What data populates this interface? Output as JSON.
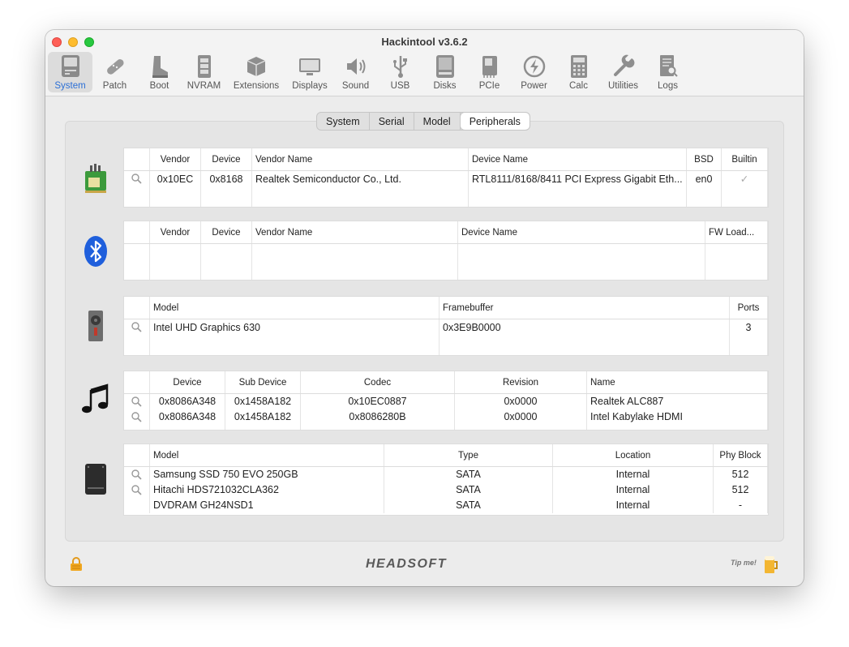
{
  "window": {
    "title": "Hackintool v3.6.2"
  },
  "toolbar": {
    "items": [
      {
        "label": "System",
        "icon": "system-icon"
      },
      {
        "label": "Patch",
        "icon": "patch-icon"
      },
      {
        "label": "Boot",
        "icon": "boot-icon"
      },
      {
        "label": "NVRAM",
        "icon": "nvram-icon"
      },
      {
        "label": "Extensions",
        "icon": "extensions-icon"
      },
      {
        "label": "Displays",
        "icon": "displays-icon"
      },
      {
        "label": "Sound",
        "icon": "sound-icon"
      },
      {
        "label": "USB",
        "icon": "usb-icon"
      },
      {
        "label": "Disks",
        "icon": "disks-icon"
      },
      {
        "label": "PCIe",
        "icon": "pcie-icon"
      },
      {
        "label": "Power",
        "icon": "power-icon"
      },
      {
        "label": "Calc",
        "icon": "calc-icon"
      },
      {
        "label": "Utilities",
        "icon": "utilities-icon"
      },
      {
        "label": "Logs",
        "icon": "logs-icon"
      }
    ],
    "active": "System"
  },
  "tabs": {
    "items": [
      "System",
      "Serial",
      "Model",
      "Peripherals"
    ],
    "active": "Peripherals"
  },
  "network": {
    "headers": [
      "Vendor",
      "Device",
      "Vendor Name",
      "Device Name",
      "BSD",
      "Builtin"
    ],
    "rows": [
      {
        "vendor": "0x10EC",
        "device": "0x8168",
        "vendor_name": "Realtek Semiconductor Co., Ltd.",
        "device_name": "RTL8111/8168/8411 PCI Express Gigabit Eth...",
        "bsd": "en0",
        "builtin": "✓"
      }
    ]
  },
  "bluetooth": {
    "headers": [
      "Vendor",
      "Device",
      "Vendor Name",
      "Device Name",
      "FW Load..."
    ]
  },
  "graphics": {
    "headers": [
      "Model",
      "Framebuffer",
      "Ports"
    ],
    "rows": [
      {
        "model": "Intel UHD Graphics 630",
        "framebuffer": "0x3E9B0000",
        "ports": "3"
      }
    ]
  },
  "audio": {
    "headers": [
      "Device",
      "Sub Device",
      "Codec",
      "Revision",
      "Name"
    ],
    "rows": [
      {
        "device": "0x8086A348",
        "sub_device": "0x1458A182",
        "codec": "0x10EC0887",
        "revision": "0x0000",
        "name": "Realtek ALC887"
      },
      {
        "device": "0x8086A348",
        "sub_device": "0x1458A182",
        "codec": "0x8086280B",
        "revision": "0x0000",
        "name": "Intel Kabylake HDMI"
      }
    ]
  },
  "storage": {
    "headers": [
      "Model",
      "Type",
      "Location",
      "Phy Block"
    ],
    "rows": [
      {
        "model": "Samsung SSD 750 EVO 250GB",
        "type": "SATA",
        "location": "Internal",
        "phy_block": "512"
      },
      {
        "model": "Hitachi HDS721032CLA362",
        "type": "SATA",
        "location": "Internal",
        "phy_block": "512"
      },
      {
        "model": "DVDRAM GH24NSD1",
        "type": "SATA",
        "location": "Internal",
        "phy_block": "-"
      }
    ]
  },
  "footer": {
    "brand": "HEADSOFT",
    "tip": "Tip me!"
  },
  "colors": {
    "accent": "#2b6fd6",
    "close": "#fe5f57",
    "minimize": "#febc2e",
    "maximize": "#28c840"
  }
}
